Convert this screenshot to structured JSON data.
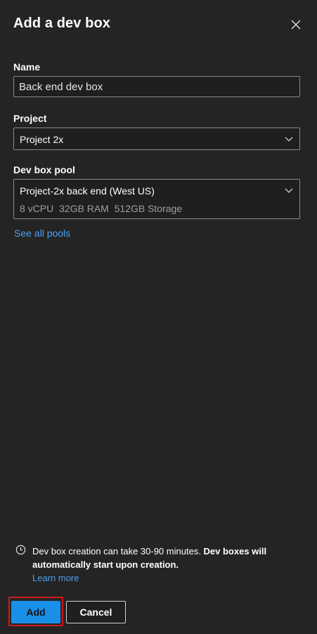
{
  "dialog": {
    "title": "Add a dev box",
    "close_icon": "close-icon"
  },
  "form": {
    "name": {
      "label": "Name",
      "value": "Back end dev box"
    },
    "project": {
      "label": "Project",
      "value": "Project 2x"
    },
    "pool": {
      "label": "Dev box pool",
      "value": "Project-2x back end (West US)",
      "details": "8 vCPU  32GB RAM  512GB Storage"
    },
    "see_all_pools": "See all pools"
  },
  "info": {
    "icon": "clock-icon",
    "text": "Dev box creation can take 30-90 minutes. ",
    "bold": "Dev boxes will automatically start upon creation.",
    "link": "Learn more"
  },
  "actions": {
    "add_label": "Add",
    "cancel_label": "Cancel",
    "highlight_color": "#d11a1a"
  }
}
